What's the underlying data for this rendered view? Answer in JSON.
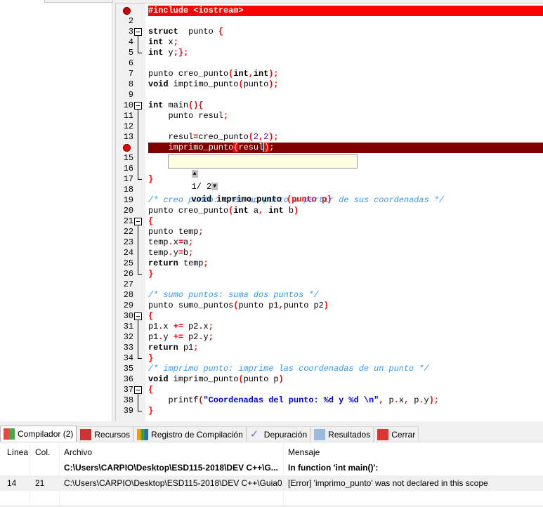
{
  "editor": {
    "lines": [
      {
        "n": "1",
        "state": "err1",
        "segs": [
          [
            "p",
            "#include <iostream>"
          ]
        ]
      },
      {
        "n": "2",
        "segs": []
      },
      {
        "n": "3",
        "fold": true,
        "segs": [
          [
            "k",
            "struct"
          ],
          [
            "",
            "  punto "
          ],
          [
            "p",
            "{"
          ]
        ]
      },
      {
        "n": "4",
        "segs": [
          [
            "k",
            "int"
          ],
          [
            "",
            " x"
          ],
          [
            "p",
            ";"
          ]
        ]
      },
      {
        "n": "5",
        "segs": [
          [
            "k",
            "int"
          ],
          [
            "",
            " y"
          ],
          [
            "p",
            ";};"
          ]
        ]
      },
      {
        "n": "6",
        "segs": []
      },
      {
        "n": "7",
        "segs": [
          [
            "",
            "punto creo_punto"
          ],
          [
            "p",
            "("
          ],
          [
            "k",
            "int"
          ],
          [
            "p",
            ","
          ],
          [
            "k",
            "int"
          ],
          [
            "p",
            ");"
          ]
        ]
      },
      {
        "n": "8",
        "segs": [
          [
            "k",
            "void"
          ],
          [
            "",
            " imptimo_punto"
          ],
          [
            "p",
            "("
          ],
          [
            "",
            "punto"
          ],
          [
            "p",
            ");"
          ]
        ]
      },
      {
        "n": "9",
        "segs": []
      },
      {
        "n": "10",
        "fold": true,
        "segs": [
          [
            "k",
            "int"
          ],
          [
            "",
            " main"
          ],
          [
            "p",
            "(){"
          ]
        ]
      },
      {
        "n": "11",
        "segs": [
          [
            "",
            "    punto resul"
          ],
          [
            "p",
            ";"
          ]
        ]
      },
      {
        "n": "12",
        "segs": []
      },
      {
        "n": "13",
        "segs": [
          [
            "",
            "    resul"
          ],
          [
            "p",
            "="
          ],
          [
            "",
            "creo_punto"
          ],
          [
            "p",
            "("
          ],
          [
            "n",
            "2"
          ],
          [
            "p",
            ","
          ],
          [
            "n",
            "2"
          ],
          [
            "p",
            ");"
          ]
        ]
      },
      {
        "n": "14",
        "state": "err2",
        "segs": [
          [
            "",
            "    imprimo_punto"
          ],
          [
            "hl",
            "("
          ],
          [
            "",
            "resul"
          ],
          [
            "caret",
            ""
          ],
          [
            "hl",
            ")"
          ],
          [
            "",
            ";"
          ]
        ]
      },
      {
        "n": "15",
        "segs": []
      },
      {
        "n": "16",
        "segs": []
      },
      {
        "n": "17",
        "segs": [
          [
            "p",
            "}"
          ]
        ]
      },
      {
        "n": "18",
        "segs": []
      },
      {
        "n": "19",
        "segs": [
          [
            "c",
            "/* creo punto: crea un punto a partir de sus coordenadas */"
          ]
        ]
      },
      {
        "n": "20",
        "segs": [
          [
            "",
            "punto creo_punto"
          ],
          [
            "p",
            "("
          ],
          [
            "k",
            "int"
          ],
          [
            "",
            " a"
          ],
          [
            "p",
            ","
          ],
          [
            "",
            ""
          ],
          [
            "k",
            " int"
          ],
          [
            "",
            " b"
          ],
          [
            "p",
            ")"
          ]
        ]
      },
      {
        "n": "21",
        "fold": true,
        "segs": [
          [
            "p",
            "{"
          ]
        ]
      },
      {
        "n": "22",
        "segs": [
          [
            "",
            "punto temp"
          ],
          [
            "p",
            ";"
          ]
        ]
      },
      {
        "n": "23",
        "segs": [
          [
            "",
            "temp"
          ],
          [
            "p",
            "."
          ],
          [
            "",
            "x"
          ],
          [
            "p",
            "="
          ],
          [
            "",
            "a"
          ],
          [
            "p",
            ";"
          ]
        ]
      },
      {
        "n": "24",
        "segs": [
          [
            "",
            "temp"
          ],
          [
            "p",
            "."
          ],
          [
            "",
            "y"
          ],
          [
            "p",
            "="
          ],
          [
            "",
            "b"
          ],
          [
            "p",
            ";"
          ]
        ]
      },
      {
        "n": "25",
        "segs": [
          [
            "k",
            "return"
          ],
          [
            "",
            " temp"
          ],
          [
            "p",
            ";"
          ]
        ]
      },
      {
        "n": "26",
        "segs": [
          [
            "p",
            "}"
          ]
        ]
      },
      {
        "n": "27",
        "segs": []
      },
      {
        "n": "28",
        "segs": [
          [
            "c",
            "/* sumo puntos: suma dos puntos */"
          ]
        ]
      },
      {
        "n": "29",
        "segs": [
          [
            "",
            "punto sumo_puntos"
          ],
          [
            "p",
            "("
          ],
          [
            "",
            "punto p1"
          ],
          [
            "p",
            ","
          ],
          [
            "",
            "punto p2"
          ],
          [
            "p",
            ")"
          ]
        ]
      },
      {
        "n": "30",
        "fold": true,
        "segs": [
          [
            "p",
            "{"
          ]
        ]
      },
      {
        "n": "31",
        "segs": [
          [
            "",
            "p1"
          ],
          [
            "p",
            "."
          ],
          [
            "",
            "x "
          ],
          [
            "p",
            "+="
          ],
          [
            "",
            " p2"
          ],
          [
            "p",
            "."
          ],
          [
            "",
            "x"
          ],
          [
            "p",
            ";"
          ]
        ]
      },
      {
        "n": "32",
        "segs": [
          [
            "",
            "p1"
          ],
          [
            "p",
            "."
          ],
          [
            "",
            "y "
          ],
          [
            "p",
            "+="
          ],
          [
            "",
            " p2"
          ],
          [
            "p",
            "."
          ],
          [
            "",
            "y"
          ],
          [
            "p",
            ";"
          ]
        ]
      },
      {
        "n": "33",
        "segs": [
          [
            "k",
            "return"
          ],
          [
            "",
            " p1"
          ],
          [
            "p",
            ";"
          ]
        ]
      },
      {
        "n": "34",
        "segs": [
          [
            "p",
            "}"
          ]
        ]
      },
      {
        "n": "35",
        "segs": [
          [
            "c",
            "/* imprimo punto: imprime las coordenadas de un punto */"
          ]
        ]
      },
      {
        "n": "36",
        "segs": [
          [
            "k",
            "void"
          ],
          [
            "",
            " imprimo_punto"
          ],
          [
            "p",
            "("
          ],
          [
            "",
            "punto p"
          ],
          [
            "p",
            ")"
          ]
        ]
      },
      {
        "n": "37",
        "fold": true,
        "segs": [
          [
            "p",
            "{"
          ]
        ]
      },
      {
        "n": "38",
        "segs": [
          [
            "",
            "    printf"
          ],
          [
            "p",
            "("
          ],
          [
            "s",
            "\"Coordenadas del punto: %d y %d \\n\""
          ],
          [
            "p",
            ","
          ],
          [
            "",
            " p"
          ],
          [
            "p",
            "."
          ],
          [
            "",
            "x"
          ],
          [
            "p",
            ","
          ],
          [
            "",
            " p"
          ],
          [
            "p",
            "."
          ],
          [
            "",
            "y"
          ],
          [
            "p",
            ");"
          ]
        ]
      },
      {
        "n": "39",
        "segs": [
          [
            "p",
            "}"
          ]
        ]
      }
    ],
    "tooltip": {
      "counter": "1/ 2",
      "signature": "void imprimo_punto ",
      "params": "(punto p)"
    }
  },
  "bottom_tabs": [
    {
      "label": "Compilador (2)",
      "icon": "compiler-grid-icon",
      "active": true
    },
    {
      "label": "Recursos",
      "icon": "resources-icon"
    },
    {
      "label": "Registro de Compilación",
      "icon": "bar-chart-icon"
    },
    {
      "label": "Depuración",
      "icon": "checkmark-icon"
    },
    {
      "label": "Resultados",
      "icon": "magnifier-icon"
    },
    {
      "label": "Cerrar",
      "icon": "close-icon"
    }
  ],
  "results": {
    "headers": {
      "line": "Línea",
      "col": "Col.",
      "file": "Archivo",
      "msg": "Mensaje"
    },
    "rows": [
      {
        "line": "",
        "col": "",
        "file": "C:\\Users\\CARPIO\\Desktop\\ESD115-2018\\DEV C++\\G...",
        "msg": "In function 'int main()':",
        "bold": true
      },
      {
        "line": "14",
        "col": "21",
        "file": "C:\\Users\\CARPIO\\Desktop\\ESD115-2018\\DEV C++\\Guia0...",
        "msg": "[Error] 'imprimo_punto' was not declared in this scope"
      }
    ]
  },
  "colors": {
    "error_line": "#ff0000",
    "current_error_line": "#800000",
    "comment": "#3399ff",
    "symbol": "#ff0000",
    "string": "#0000ff"
  }
}
